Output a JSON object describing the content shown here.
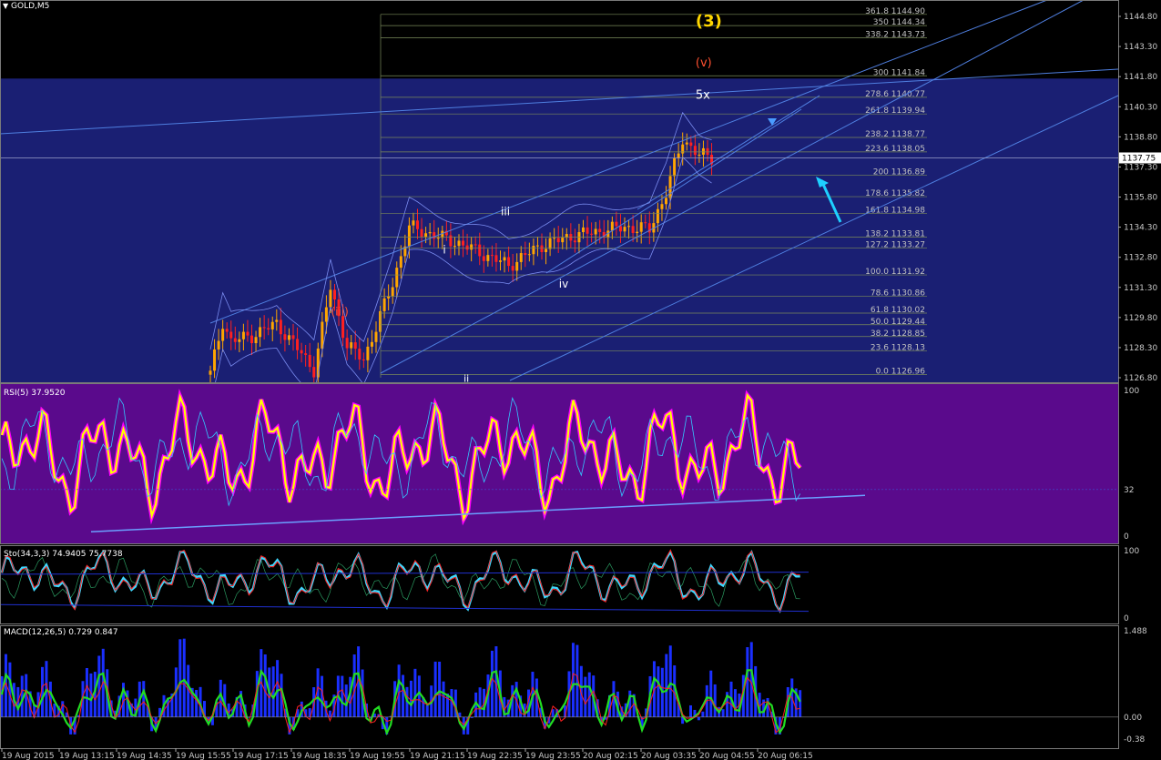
{
  "window": {
    "title": "GOLD,M5",
    "menu_icon": "triangle-down-icon"
  },
  "colors": {
    "background": "#000000",
    "price_band": "#1a1f73",
    "rsi_band": "#5a0a8c",
    "axis_text": "#c8c8c8",
    "grid": "#3a3a3a",
    "bull": "#ffa500",
    "bear": "#ff2020",
    "channel": "#4f7fe0",
    "fib": "#7a8a5a",
    "arrow": "#1ed0ff",
    "wave3": "#ffd700",
    "wave_v": "#ff5030",
    "wave_iii": "#ff5030",
    "wave_small": "#ffffff",
    "rsi_main": "#ffff00",
    "rsi_glow": "#ff00ff",
    "sto_main": "#3ed8ff",
    "sto_signal": "#ff2020",
    "macd_hist": "#1a2fff",
    "macd_line": "#22dd22",
    "macd_signal": "#ff2020"
  },
  "price_panel": {
    "current_price": "1137.75",
    "axis_labels": [
      "1144.80",
      "1143.30",
      "1141.80",
      "1140.30",
      "1138.80",
      "1137.30",
      "1135.80",
      "1134.30",
      "1132.80",
      "1131.30",
      "1129.80",
      "1128.30",
      "1126.80"
    ],
    "axis_values": [
      1144.8,
      1143.3,
      1141.8,
      1140.3,
      1138.8,
      1137.3,
      1135.8,
      1134.3,
      1132.8,
      1131.3,
      1129.8,
      1128.3,
      1126.8
    ],
    "wave_labels": [
      {
        "text": "(3)",
        "color": "wave3",
        "price": 1144.3,
        "bar": 118,
        "size": 18
      },
      {
        "text": "(v)",
        "color": "wave_v",
        "price": 1142.3,
        "bar": 118,
        "size": 13
      },
      {
        "text": "5x",
        "color": "wave_small",
        "price": 1140.7,
        "bar": 118,
        "size": 13
      },
      {
        "text": "iii",
        "color": "wave_small",
        "price": 1134.9,
        "bar": 71,
        "size": 12
      },
      {
        "text": "i",
        "color": "wave_small",
        "price": 1133.0,
        "bar": 57,
        "size": 12
      },
      {
        "text": "iv",
        "color": "wave_small",
        "price": 1131.3,
        "bar": 85,
        "size": 12
      },
      {
        "text": "(iii)",
        "color": "wave_iii",
        "price": 1129.9,
        "bar": 30,
        "size": 12
      },
      {
        "text": "ii",
        "color": "wave_small",
        "price": 1126.6,
        "bar": 62,
        "size": 11
      }
    ],
    "fib_levels": [
      {
        "label": "361.8  1144.90",
        "price": 1144.9
      },
      {
        "label": "350  1144.34",
        "price": 1144.34
      },
      {
        "label": "338.2  1143.73",
        "price": 1143.73
      },
      {
        "label": "300  1141.84",
        "price": 1141.84
      },
      {
        "label": "278.6  1140.77",
        "price": 1140.77
      },
      {
        "label": "261.8  1139.94",
        "price": 1139.94
      },
      {
        "label": "238.2  1138.77",
        "price": 1138.77
      },
      {
        "label": "223.6  1138.05",
        "price": 1138.05
      },
      {
        "label": "200  1136.89",
        "price": 1136.89
      },
      {
        "label": "178.6  1135.82",
        "price": 1135.82
      },
      {
        "label": "161.8  1134.98",
        "price": 1134.98
      },
      {
        "label": "138.2  1133.81",
        "price": 1133.81
      },
      {
        "label": "127.2  1133.27",
        "price": 1133.27
      },
      {
        "label": "100.0  1131.92",
        "price": 1131.92
      },
      {
        "label": "78.6  1130.86",
        "price": 1130.86
      },
      {
        "label": "61.8  1130.02",
        "price": 1130.02
      },
      {
        "label": "50.0  1129.44",
        "price": 1129.44
      },
      {
        "label": "38.2  1128.85",
        "price": 1128.85
      },
      {
        "label": "23.6  1128.13",
        "price": 1128.13
      },
      {
        "label": "0.0  1126.96",
        "price": 1126.96
      }
    ]
  },
  "rsi_panel": {
    "title": "RSI(5) 37.9520",
    "levels": [
      "100",
      "32",
      "0"
    ]
  },
  "sto_panel": {
    "title": "Sto(34,3,3) 74.9405 75.7738",
    "levels": [
      "100",
      "0"
    ]
  },
  "macd_panel": {
    "title": "MACD(12,26,5) 0.729 0.847",
    "levels": [
      "1.488",
      "0.00",
      "-0.38"
    ]
  },
  "time_axis": [
    "19 Aug 2015",
    "19 Aug 13:15",
    "19 Aug 14:35",
    "19 Aug 15:55",
    "19 Aug 17:15",
    "19 Aug 18:35",
    "19 Aug 19:55",
    "19 Aug 21:15",
    "19 Aug 22:35",
    "19 Aug 23:55",
    "20 Aug 02:15",
    "20 Aug 03:35",
    "20 Aug 04:55",
    "20 Aug 06:15"
  ],
  "chart_data": {
    "type": "line",
    "title": "GOLD,M5",
    "xlabel": "",
    "ylabel": "",
    "ylim": [
      1126.5,
      1145.2
    ],
    "x": [
      "19 Aug 2015",
      "19 Aug 13:15",
      "19 Aug 14:35",
      "19 Aug 15:55",
      "19 Aug 17:15",
      "19 Aug 18:35",
      "19 Aug 19:55",
      "19 Aug 21:15",
      "19 Aug 22:35",
      "19 Aug 23:55",
      "20 Aug 02:15",
      "20 Aug 03:35",
      "20 Aug 04:55",
      "20 Aug 06:15"
    ],
    "series": [
      {
        "name": "GOLD,M5",
        "values": [
          1127.0,
          1128.5,
          1129.0,
          1128.4,
          1127.6,
          1130.3,
          1128.3,
          1131.8,
          1134.1,
          1133.6,
          1132.6,
          1134.0,
          1134.2,
          1138.2
        ]
      }
    ]
  }
}
